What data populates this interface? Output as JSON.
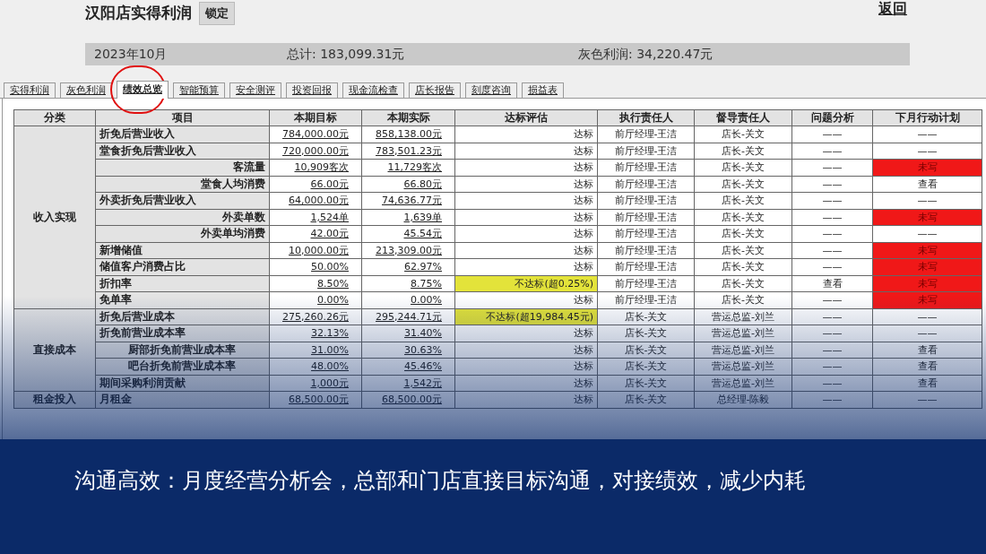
{
  "header": {
    "title": "汉阳店实得利润",
    "lock_button": "锁定",
    "back_link": "返回"
  },
  "summary": {
    "month": "2023年10月",
    "total": "总计: 183,099.31元",
    "gray_profit": "灰色利润: 34,220.47元"
  },
  "tabs": [
    {
      "label": "实得利润",
      "selected": false,
      "circled": false
    },
    {
      "label": "灰色利润",
      "selected": false,
      "circled": false
    },
    {
      "label": "绩效总览",
      "selected": true,
      "circled": true
    },
    {
      "label": "智能预算",
      "selected": false,
      "circled": false
    },
    {
      "label": "安全测评",
      "selected": false,
      "circled": false
    },
    {
      "label": "投资回报",
      "selected": false,
      "circled": false
    },
    {
      "label": "现金流检查",
      "selected": false,
      "circled": false
    },
    {
      "label": "店长报告",
      "selected": false,
      "circled": false
    },
    {
      "label": "刻度咨询",
      "selected": false,
      "circled": false
    },
    {
      "label": "损益表",
      "selected": false,
      "circled": false
    }
  ],
  "table": {
    "columns": [
      "分类",
      "项目",
      "本期目标",
      "本期实际",
      "达标评估",
      "执行责任人",
      "督导责任人",
      "问题分析",
      "下月行动计划"
    ],
    "groups": [
      {
        "category": "收入实现",
        "rows": [
          {
            "item": "折免后营业收入",
            "kind": "left",
            "target": "784,000.00元",
            "actual": "858,138.00元",
            "evaluation": "达标",
            "met": true,
            "executor": "前厅经理-王洁",
            "supervisor": "店长-关文",
            "analysis": "——",
            "plan": "——",
            "plan_missing": false
          },
          {
            "item": "堂食折免后营业收入",
            "kind": "left",
            "target": "720,000.00元",
            "actual": "783,501.23元",
            "evaluation": "达标",
            "met": true,
            "executor": "前厅经理-王洁",
            "supervisor": "店长-关文",
            "analysis": "——",
            "plan": "——",
            "plan_missing": false
          },
          {
            "item": "客流量",
            "kind": "right",
            "target": "10,909客次",
            "actual": "11,729客次",
            "evaluation": "达标",
            "met": true,
            "executor": "前厅经理-王洁",
            "supervisor": "店长-关文",
            "analysis": "——",
            "plan": "未写",
            "plan_missing": true
          },
          {
            "item": "堂食人均消费",
            "kind": "right",
            "target": "66.00元",
            "actual": "66.80元",
            "evaluation": "达标",
            "met": true,
            "executor": "前厅经理-王洁",
            "supervisor": "店长-关文",
            "analysis": "——",
            "plan": "查看",
            "plan_missing": false
          },
          {
            "item": "外卖折免后营业收入",
            "kind": "left",
            "target": "64,000.00元",
            "actual": "74,636.77元",
            "evaluation": "达标",
            "met": true,
            "executor": "前厅经理-王洁",
            "supervisor": "店长-关文",
            "analysis": "——",
            "plan": "——",
            "plan_missing": false
          },
          {
            "item": "外卖单数",
            "kind": "right",
            "target": "1,524单",
            "actual": "1,639单",
            "evaluation": "达标",
            "met": true,
            "executor": "前厅经理-王洁",
            "supervisor": "店长-关文",
            "analysis": "——",
            "plan": "未写",
            "plan_missing": true
          },
          {
            "item": "外卖单均消费",
            "kind": "right",
            "target": "42.00元",
            "actual": "45.54元",
            "evaluation": "达标",
            "met": true,
            "executor": "前厅经理-王洁",
            "supervisor": "店长-关文",
            "analysis": "——",
            "plan": "——",
            "plan_missing": false
          },
          {
            "item": "新增储值",
            "kind": "left",
            "target": "10,000.00元",
            "actual": "213,309.00元",
            "evaluation": "达标",
            "met": true,
            "executor": "前厅经理-王洁",
            "supervisor": "店长-关文",
            "analysis": "——",
            "plan": "未写",
            "plan_missing": true
          },
          {
            "item": "储值客户消费占比",
            "kind": "left",
            "target": "50.00%",
            "actual": "62.97%",
            "evaluation": "达标",
            "met": true,
            "executor": "前厅经理-王洁",
            "supervisor": "店长-关文",
            "analysis": "——",
            "plan": "未写",
            "plan_missing": true
          },
          {
            "item": "折扣率",
            "kind": "left",
            "target": "8.50%",
            "actual": "8.75%",
            "evaluation": "不达标(超0.25%)",
            "met": false,
            "executor": "前厅经理-王洁",
            "supervisor": "店长-关文",
            "analysis": "查看",
            "plan": "未写",
            "plan_missing": true
          },
          {
            "item": "免单率",
            "kind": "left",
            "target": "0.00%",
            "actual": "0.00%",
            "evaluation": "达标",
            "met": true,
            "executor": "前厅经理-王洁",
            "supervisor": "店长-关文",
            "analysis": "——",
            "plan": "未写",
            "plan_missing": true
          }
        ]
      },
      {
        "category": "直接成本",
        "rows": [
          {
            "item": "折免后营业成本",
            "kind": "left",
            "target": "275,260.26元",
            "actual": "295,244.71元",
            "evaluation": "不达标(超19,984.45元)",
            "met": false,
            "executor": "店长-关文",
            "supervisor": "营运总监-刘兰",
            "analysis": "——",
            "plan": "——",
            "plan_missing": false
          },
          {
            "item": "折免前营业成本率",
            "kind": "left",
            "target": "32.13%",
            "actual": "31.40%",
            "evaluation": "达标",
            "met": true,
            "executor": "店长-关文",
            "supervisor": "营运总监-刘兰",
            "analysis": "——",
            "plan": "——",
            "plan_missing": false
          },
          {
            "item": "厨部折免前营业成本率",
            "kind": "indent",
            "target": "31.00%",
            "actual": "30.63%",
            "evaluation": "达标",
            "met": true,
            "executor": "店长-关文",
            "supervisor": "营运总监-刘兰",
            "analysis": "——",
            "plan": "查看",
            "plan_missing": false
          },
          {
            "item": "吧台折免前营业成本率",
            "kind": "indent",
            "target": "48.00%",
            "actual": "45.46%",
            "evaluation": "达标",
            "met": true,
            "executor": "店长-关文",
            "supervisor": "营运总监-刘兰",
            "analysis": "——",
            "plan": "查看",
            "plan_missing": false
          },
          {
            "item": "期间采购利润贡献",
            "kind": "left",
            "target": "1,000元",
            "actual": "1,542元",
            "evaluation": "达标",
            "met": true,
            "executor": "店长-关文",
            "supervisor": "营运总监-刘兰",
            "analysis": "——",
            "plan": "查看",
            "plan_missing": false
          }
        ]
      },
      {
        "category": "租金投入",
        "rows": [
          {
            "item": "月租金",
            "kind": "left",
            "target": "68,500.00元",
            "actual": "68,500.00元",
            "evaluation": "达标",
            "met": true,
            "executor": "店长-关文",
            "supervisor": "总经理-陈毅",
            "analysis": "——",
            "plan": "——",
            "plan_missing": false
          }
        ]
      }
    ]
  },
  "caption": "沟通高效：月度经营分析会，总部和门店直接目标沟通，对接绩效，减少内耗"
}
